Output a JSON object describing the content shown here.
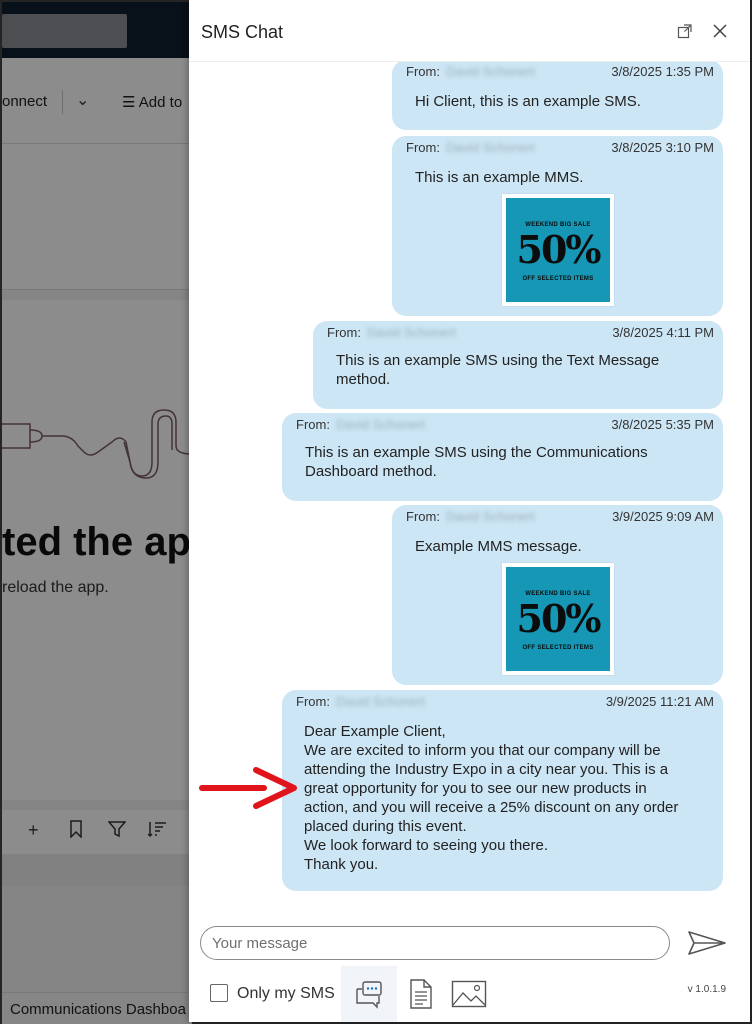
{
  "background_app": {
    "connect_label": "onnect",
    "add_to_label": "Add to",
    "heading": "ted the ap",
    "subtext": "reload the app.",
    "footer_tab": "Communications Dashboa"
  },
  "panel": {
    "title": "SMS Chat",
    "expand_icon": "expand-icon",
    "close_icon": "close-icon"
  },
  "messages": [
    {
      "from_label": "From:",
      "sender": "David Schonert",
      "time": "3/8/2025 1:35 PM",
      "text": "Hi Client, this is an example SMS.",
      "has_image": false
    },
    {
      "from_label": "From:",
      "sender": "David Schonert",
      "time": "3/8/2025 3:10 PM",
      "text": "This is an example MMS.",
      "has_image": true
    },
    {
      "from_label": "From:",
      "sender": "David Schonert",
      "time": "3/8/2025 4:11 PM",
      "text": "This is an example SMS using the Text Message\nmethod.",
      "has_image": false
    },
    {
      "from_label": "From:",
      "sender": "David Schonert",
      "time": "3/8/2025 5:35 PM",
      "text": "This is an example SMS using the Communications\nDashboard method.",
      "has_image": false
    },
    {
      "from_label": "From:",
      "sender": "David Schonert",
      "time": "3/9/2025 9:09 AM",
      "text": "Example MMS message.",
      "has_image": true
    },
    {
      "from_label": "From:",
      "sender": "David Schonert",
      "time": "3/9/2025 11:21 AM",
      "text": "Dear Example Client,\nWe are excited to inform you that our company will be\nattending the Industry Expo in a city near you. This is a\ngreat opportunity for you to see our new products in\naction, and you will receive a 25% discount on any order\nplaced during this event.\nWe look forward to seeing you there.\nThank you.",
      "has_image": false
    }
  ],
  "promo_image": {
    "top_text": "WEEKEND BIG SALE",
    "big_text": "50%",
    "bottom_text": "OFF SELECTED ITEMS",
    "bg_color": "#1597b5"
  },
  "composer": {
    "placeholder": "Your message",
    "value": "",
    "send_icon": "send-icon"
  },
  "footer": {
    "only_my_sms_label": "Only my SMS",
    "only_my_sms_checked": false,
    "tools": [
      "sms-template-icon",
      "document-icon",
      "image-icon"
    ],
    "version": "v 1.0.1.9"
  },
  "colors": {
    "bubble": "#cde6f5",
    "accent_arrow": "#e0141b"
  }
}
